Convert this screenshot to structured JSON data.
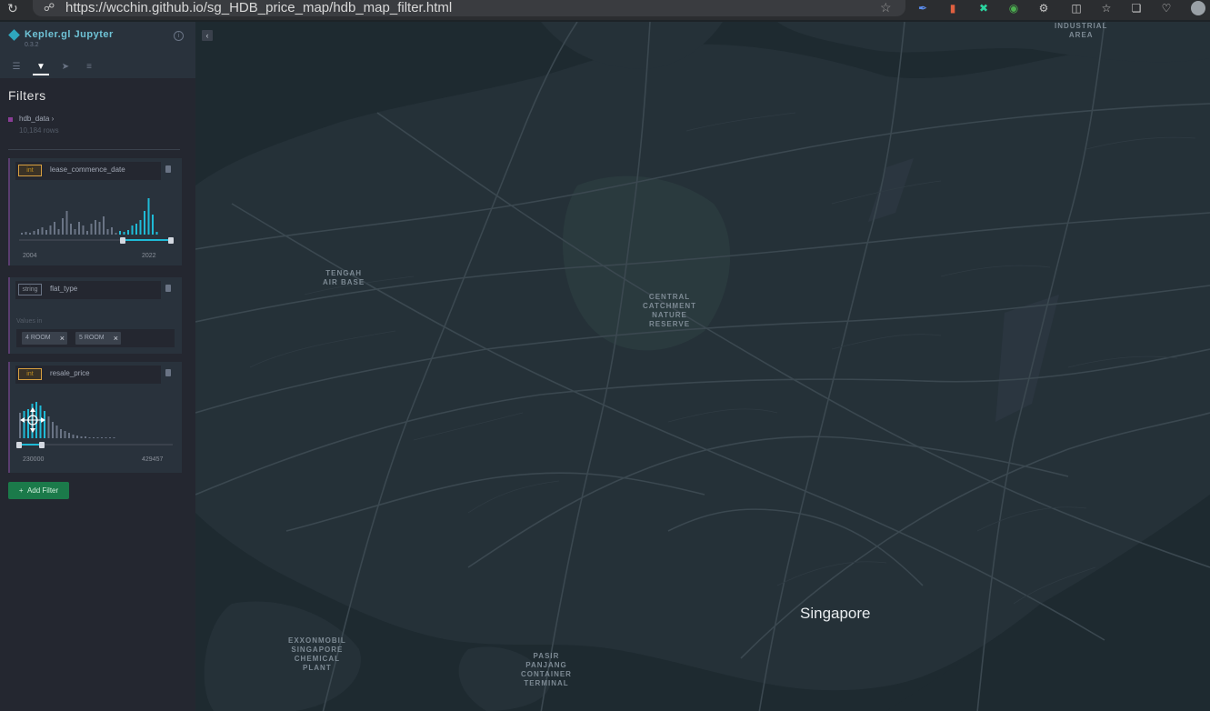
{
  "browser": {
    "url": "https://wcchin.github.io/sg_HDB_price_map/hdb_map_filter.html",
    "reload_icon": "reload-icon",
    "lock_icon": "lock-icon",
    "star_icon": "star-icon"
  },
  "panel": {
    "app_name": "Kepler.gl Jupyter",
    "version": "0.3.2",
    "tabs": [
      "layers-tab",
      "filters-tab",
      "interactions-tab",
      "map-settings-tab"
    ],
    "active_tab": "filters-tab",
    "title": "Filters",
    "dataset": {
      "name": "hdb_data",
      "rows": "10,184 rows"
    },
    "filters": [
      {
        "type": "int",
        "field": "lease_commence_date",
        "min_label": "2004",
        "max_label": "2022"
      },
      {
        "type": "string",
        "field": "flat_type",
        "values_label": "Values in",
        "chips": [
          "4 ROOM",
          "5 ROOM"
        ]
      },
      {
        "type": "int",
        "field": "resale_price",
        "min_label": "230000",
        "max_label": "429457"
      }
    ],
    "add_filter_label": "Add Filter",
    "accent_color": "#1fbad6",
    "button_color": "#1b7a4a"
  },
  "map": {
    "labels": {
      "industrial": "INDUSTRIAL\nAREA",
      "tengah": "TENGAH\nAIR BASE",
      "central": "CENTRAL\nCATCHMENT\nNATURE\nRESERVE",
      "exxon": "EXXONMOBIL\nSINGAPORE\nCHEMICAL\nPLANT",
      "pasir": "PASIR\nPANJANG\nCONTAINER\nTERMINAL",
      "singapore": "Singapore"
    }
  }
}
